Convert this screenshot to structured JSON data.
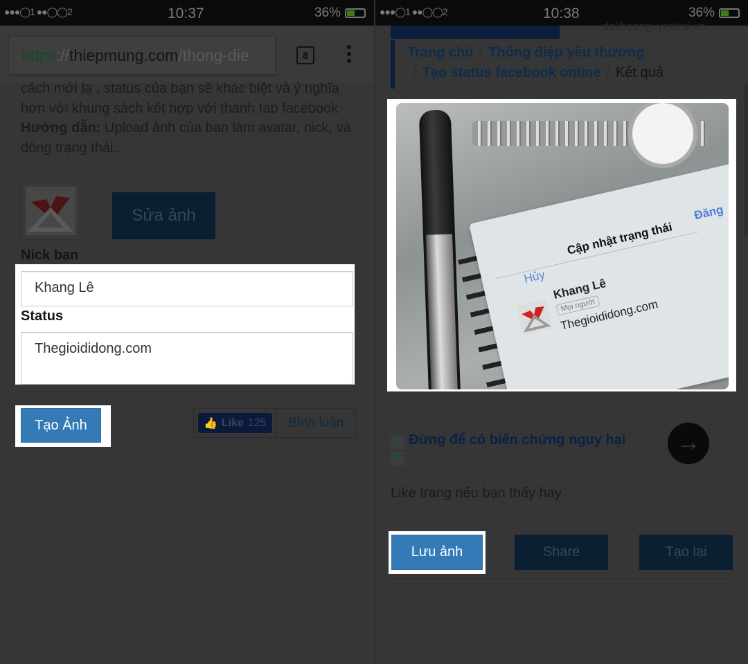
{
  "left": {
    "status": {
      "signal": "●●●◯1 ●●◯◯2",
      "time": "10:37",
      "battery": "36%"
    },
    "address_bar": {
      "scheme": "https",
      "sep": "://",
      "domain": "thiepmung.com",
      "path": "/thong-die",
      "tab_count": "8"
    },
    "description": {
      "line1": "cách mới lạ , status của bạn sẽ khác biệt và ý nghĩa",
      "line2": "hơn với khung sách kết hợp với thanh tab facebook",
      "guide_label": "Hướng dẫn:",
      "guide_text": " Upload ảnh của bạn làm avatar, nick, và dòng trạng thái.."
    },
    "edit_photo_label": "Sửa ảnh",
    "nick_label": "Nick bạn",
    "nick_value": "Khang Lê",
    "status_label": "Status",
    "status_value": "Thegioididong.com",
    "create_label": "Tạo Ảnh",
    "like_label": "Like",
    "like_count": "125",
    "comment_label": "Bình luận"
  },
  "right": {
    "status": {
      "signal": "●●●◯1 ●●◯◯2",
      "time": "10:38",
      "battery": "36%"
    },
    "top_site": "dakhoanguyentrai.vn",
    "breadcrumb": [
      "Trang chủ",
      "Thông điệp yêu thương",
      "Tạo status facebook online",
      "Kết quả"
    ],
    "result_image": {
      "title": "Cập nhật trạng thái",
      "cancel": "Hủy",
      "post": "Đăng",
      "name": "Khang Lê",
      "audience": "Mọi người",
      "status": "Thegioididong.com"
    },
    "ad_text": "Đừng để có biến chứng nguy hại",
    "like_prompt": "Like trang nếu bạn thấy hay",
    "save_label": "Lưu ảnh",
    "share_label": "Share",
    "recreate_label": "Tạo lại"
  },
  "colors": {
    "primary": "#337ab7",
    "overlay": "#363636"
  }
}
